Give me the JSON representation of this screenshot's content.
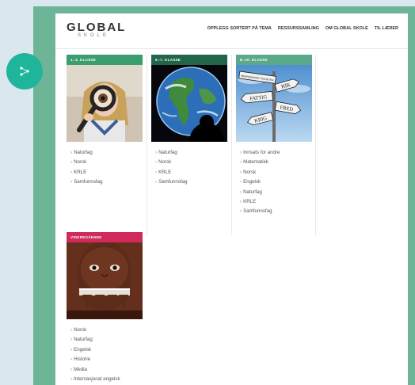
{
  "header": {
    "logo_main": "GLOBAL",
    "logo_sub": "SKOLE",
    "nav": [
      "OPPLEGG SORTERT PÅ TEMA",
      "RESSURSSAMLING",
      "OM GLOBAL SKOLE",
      "TIL LÆRER"
    ]
  },
  "cards": [
    {
      "title": "1.-4. KLASSE",
      "color": "#3a9e6e",
      "links": [
        "Naturfag",
        "Norsk",
        "KRLE",
        "Samfunnsfag"
      ]
    },
    {
      "title": "5.-7. KLASSE",
      "color": "#23654a",
      "links": [
        "Naturfag",
        "Norsk",
        "KRLE",
        "Samfunnsfag"
      ]
    },
    {
      "title": "8.-10. KLASSE",
      "color": "#5aa98a",
      "links": [
        "Innsats for andre",
        "Matematikk",
        "Norsk",
        "Engelsk",
        "Naturfag",
        "KRLE",
        "Samfunnsfag"
      ]
    },
    {
      "title": "VIDEREGÅENDE",
      "color": "#cf2a5a",
      "links": [
        "Norsk",
        "Naturfag",
        "Engelsk",
        "Historie",
        "Media",
        "Internasjonal engelsk"
      ]
    }
  ],
  "signs": [
    "MENNESKERETTIGHETER",
    "RIK",
    "FATTIG",
    "FRED",
    "KRIG"
  ],
  "colors": {
    "frame": "#6eb598",
    "share_button": "#1fb59b",
    "background": "#dbe7ef"
  }
}
